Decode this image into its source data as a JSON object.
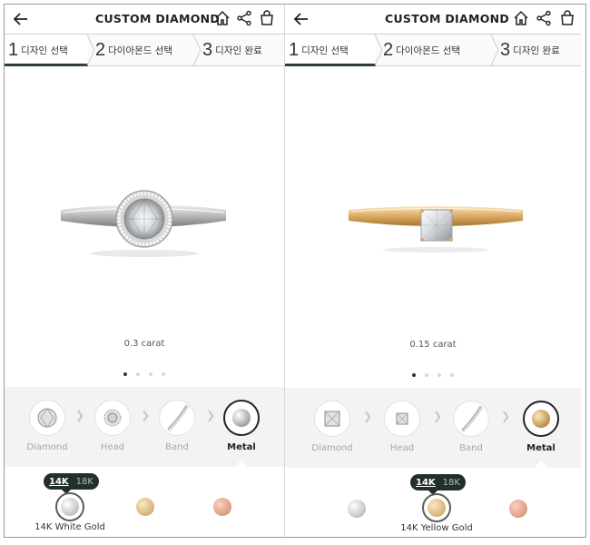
{
  "left": {
    "header": {
      "title": "CUSTOM DIAMOND"
    },
    "steps": [
      {
        "num": "1",
        "label": "디자인 선택"
      },
      {
        "num": "2",
        "label": "다이아몬드 선택"
      },
      {
        "num": "3",
        "label": "디자인 완료"
      }
    ],
    "carat": "0.3 carat",
    "options": [
      {
        "label": "Diamond"
      },
      {
        "label": "Head"
      },
      {
        "label": "Band"
      },
      {
        "label": "Metal"
      }
    ],
    "karat": {
      "selected": "14K",
      "other": "18K"
    },
    "metal_label": "14K White Gold",
    "colors": {
      "white": "#d9d9d9",
      "yellow": "#dcbd86",
      "rose": "#e5a98f",
      "dark": "#22302b"
    }
  },
  "right": {
    "header": {
      "title": "CUSTOM DIAMOND"
    },
    "steps": [
      {
        "num": "1",
        "label": "디자인 선택"
      },
      {
        "num": "2",
        "label": "다이아몬드 선택"
      },
      {
        "num": "3",
        "label": "디자인 완료"
      }
    ],
    "carat": "0.15 carat",
    "options": [
      {
        "label": "Diamond"
      },
      {
        "label": "Head"
      },
      {
        "label": "Band"
      },
      {
        "label": "Metal"
      }
    ],
    "karat": {
      "selected": "14K",
      "other": "18K"
    },
    "metal_label": "14K Yellow Gold"
  }
}
